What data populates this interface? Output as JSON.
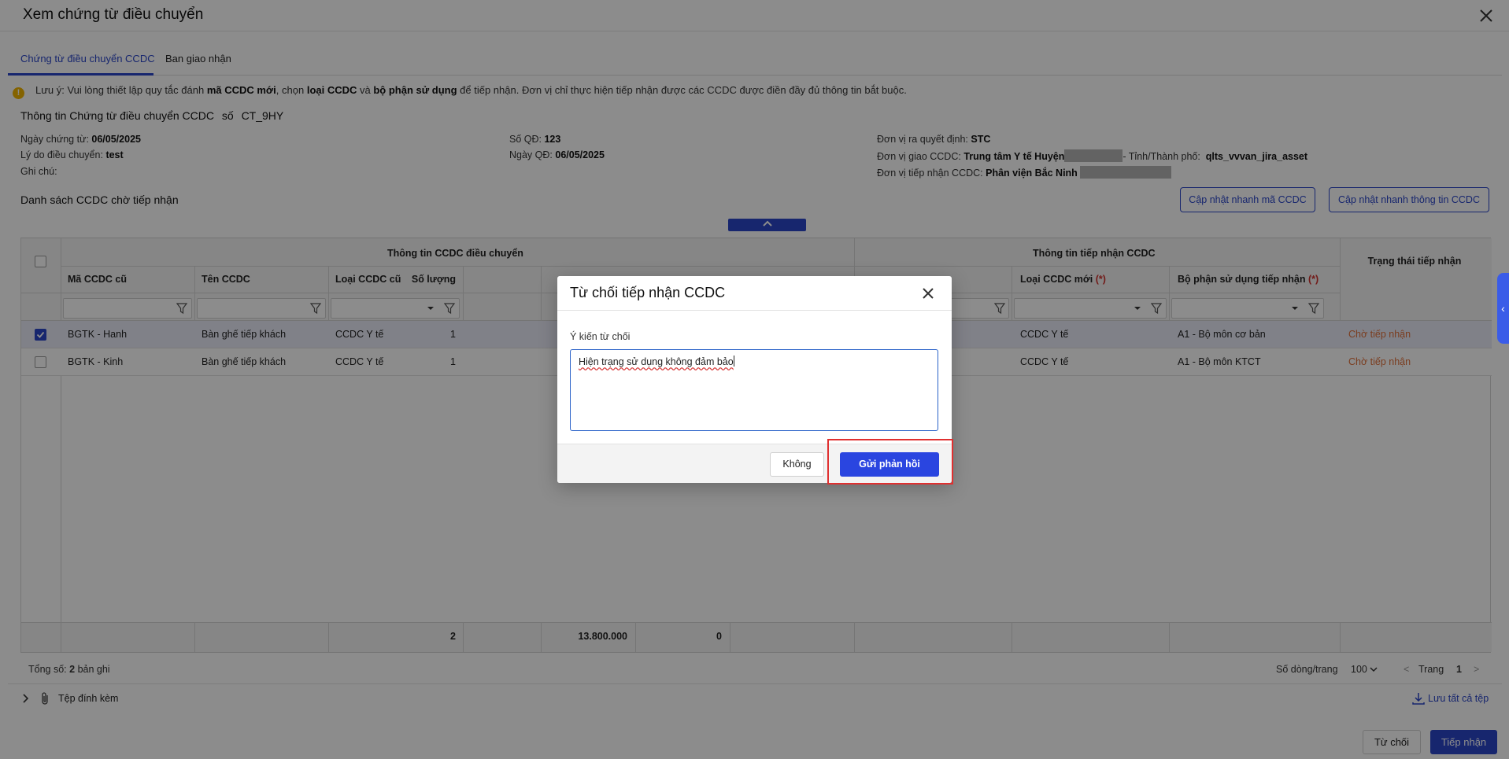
{
  "dialog": {
    "title": "Xem chứng từ điều chuyển"
  },
  "tabs": [
    {
      "label": "Chứng từ điều chuyển CCDC",
      "active": true
    },
    {
      "label": "Ban giao nhận",
      "active": false
    }
  ],
  "notice": {
    "prefix": "Lưu ý: Vui lòng thiết lập quy tắc đánh ",
    "b1": "mã CCDC mới",
    "mid1": ", chọn ",
    "b2": "loại CCDC",
    "mid2": " và ",
    "b3": "bộ phận sử dụng",
    "suffix": " để tiếp nhận. Đơn vị chỉ thực hiện tiếp nhận được các CCDC được điền đầy đủ thông tin bắt buộc."
  },
  "voucher": {
    "title": "Thông tin Chứng từ điều chuyển CCDC",
    "number_label": "số",
    "number": "CT_9HY",
    "date_label": "Ngày chứng từ:",
    "date": "06/05/2025",
    "reason_label": "Lý do điều chuyển:",
    "reason": "test",
    "note_label": "Ghi chú:",
    "decision_no_label": "Số QĐ:",
    "decision_no": "123",
    "decision_date_label": "Ngày QĐ:",
    "decision_date": "06/05/2025",
    "issuer_label": "Đơn vị ra quyết định:",
    "issuer": "STC",
    "sender_label": "Đơn vị giao CCDC:",
    "sender": "Trung tâm Y tế Huyện",
    "province_label": "- Tỉnh/Thành phố:",
    "province": "qlts_vvvan_jira_asset",
    "receiver_label": "Đơn vị tiếp nhận CCDC:",
    "receiver": "Phân viện Bắc Ninh"
  },
  "list": {
    "title": "Danh sách CCDC chờ tiếp nhận",
    "btn_quick_code": "Cập nhật nhanh mã CCDC",
    "btn_quick_info": "Cập nhật nhanh thông tin CCDC"
  },
  "table": {
    "group_transfer": "Thông tin CCDC điều chuyển",
    "group_receive": "Thông tin tiếp nhận CCDC",
    "col_status": "Trạng thái tiếp nhận",
    "col_old_code": "Mã CCDC cũ",
    "col_name": "Tên CCDC",
    "col_old_type": "Loại CCDC cũ",
    "col_qty": "Số lượng",
    "col_new_type": "Loại CCDC mới",
    "col_dept": "Bộ phận sử dụng tiếp nhận",
    "required_mark": "(*)",
    "rows": [
      {
        "checked": true,
        "old_code": "BGTK - Hanh",
        "name": "Bàn ghế tiếp khách",
        "old_type": "CCDC Y tế",
        "qty": "1",
        "new_type": "CCDC Y tế",
        "dept": "A1 - Bộ môn cơ bản",
        "status": "Chờ tiếp nhận"
      },
      {
        "checked": false,
        "old_code": "BGTK - Kinh",
        "name": "Bàn ghế tiếp khách",
        "old_type": "CCDC Y tế",
        "qty": "1",
        "new_type": "CCDC Y tế",
        "dept": "A1 - Bộ môn KTCT",
        "status": "Chờ tiếp nhận"
      }
    ],
    "footer": {
      "qty": "2",
      "amount": "13.800.000",
      "other": "0"
    }
  },
  "pagination": {
    "total_label": "Tổng số:",
    "total": "2",
    "total_unit": "bản ghi",
    "per_page_label": "Số dòng/trang",
    "per_page": "100",
    "page_label": "Trang",
    "page": "1"
  },
  "attachments": {
    "label": "Tệp đính kèm",
    "save_all": "Lưu tất cả tệp"
  },
  "actions": {
    "reject": "Từ chối",
    "accept": "Tiếp nhận"
  },
  "modal": {
    "title": "Từ chối tiếp nhận CCDC",
    "field_label": "Ý kiến từ chối",
    "value": "Hiện trạng sử dụng không đảm bảo",
    "cancel": "Không",
    "submit": "Gửi phản hồi"
  },
  "colors": {
    "primary": "#2a45c8",
    "status_pending": "#e0703a",
    "highlight": "#e03030"
  }
}
